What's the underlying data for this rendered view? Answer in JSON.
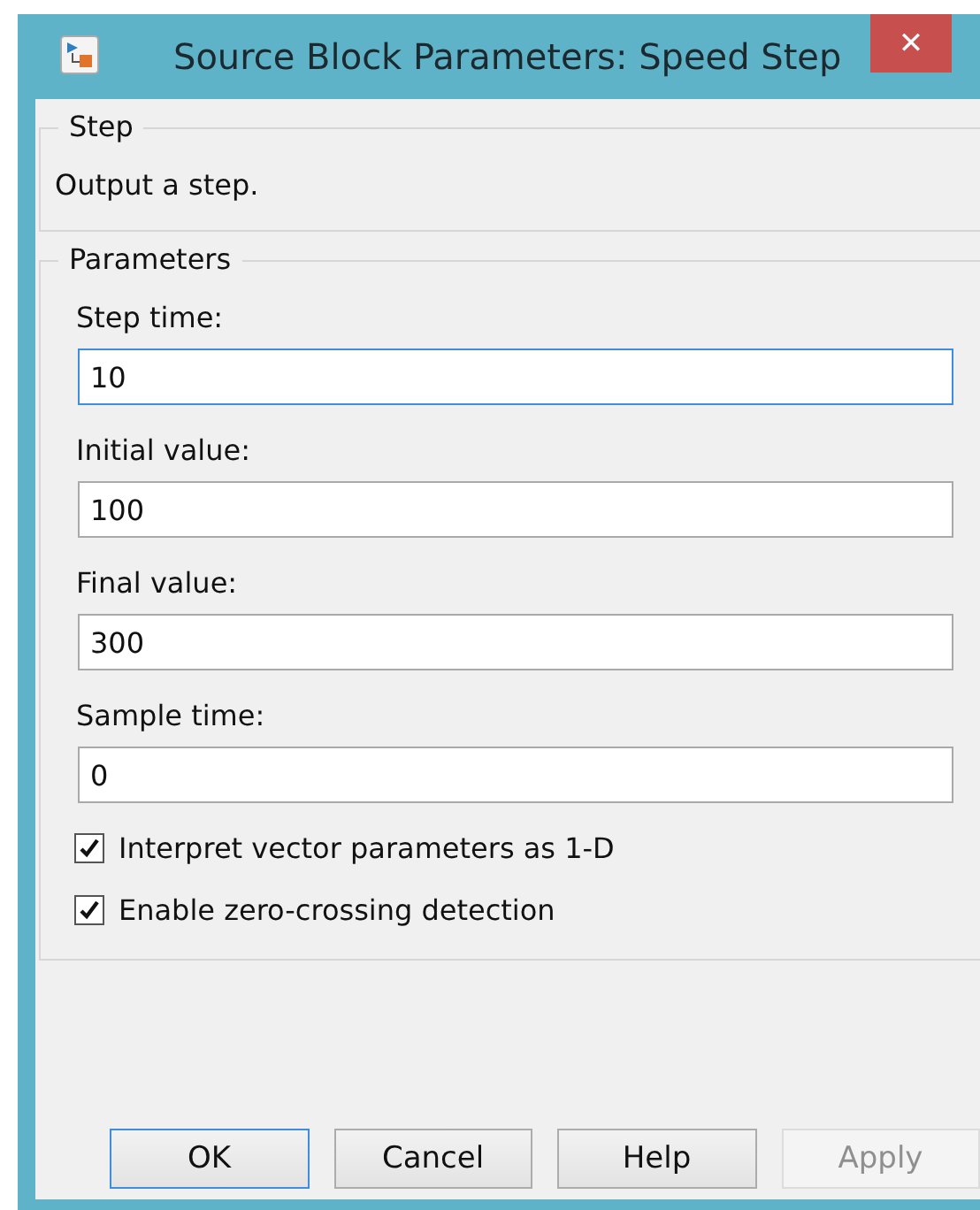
{
  "window": {
    "title": "Source Block Parameters: Speed Step",
    "close": "✕"
  },
  "description_group": {
    "title": "Step",
    "text": "Output a step."
  },
  "parameters_group": {
    "title": "Parameters",
    "fields": [
      {
        "label": "Step time:",
        "value": "10",
        "focused": true
      },
      {
        "label": "Initial value:",
        "value": "100",
        "focused": false
      },
      {
        "label": "Final value:",
        "value": "300",
        "focused": false
      },
      {
        "label": "Sample time:",
        "value": "0",
        "focused": false
      }
    ],
    "checkboxes": [
      {
        "label": "Interpret vector parameters as 1-D",
        "checked": true
      },
      {
        "label": "Enable zero-crossing detection",
        "checked": true
      }
    ]
  },
  "buttons": [
    {
      "label": "OK",
      "default": true,
      "disabled": false
    },
    {
      "label": "Cancel",
      "default": false,
      "disabled": false
    },
    {
      "label": "Help",
      "default": false,
      "disabled": false
    },
    {
      "label": "Apply",
      "default": false,
      "disabled": true
    }
  ]
}
